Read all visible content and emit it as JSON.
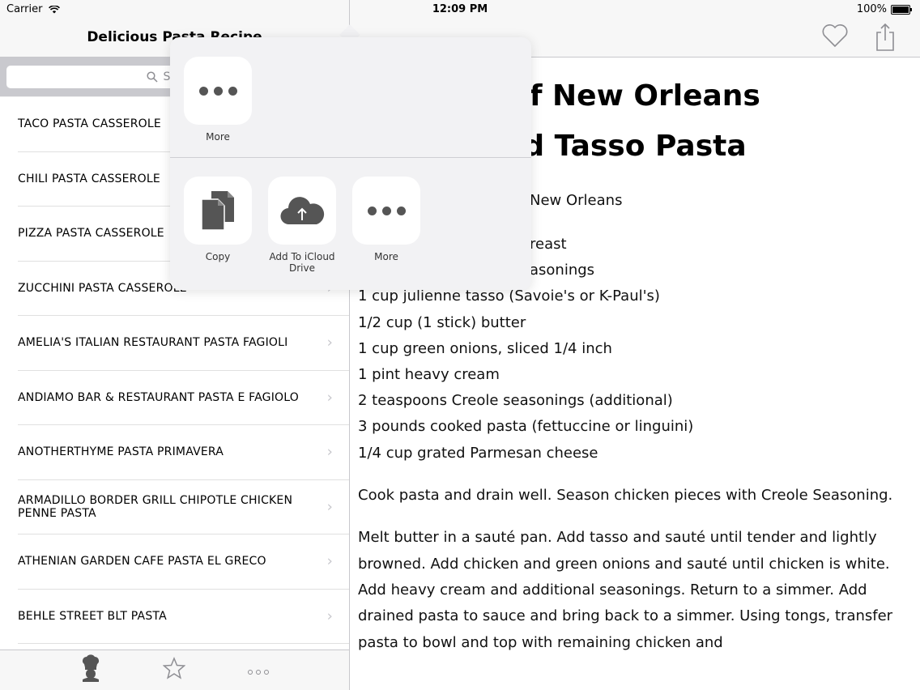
{
  "status_bar": {
    "carrier": "Carrier",
    "time": "12:09 PM",
    "battery": "100%"
  },
  "master": {
    "title": "Delicious Pasta Recipe",
    "search_placeholder": "Search",
    "recipes": [
      "TACO PASTA CASSEROLE",
      "CHILI PASTA CASSEROLE",
      "PIZZA PASTA CASSEROLE",
      "ZUCCHINI PASTA CASSEROLE",
      "AMELIA'S ITALIAN RESTAURANT PASTA FAGIOLI",
      "ANDIAMO BAR & RESTAURANT PASTA E FAGIOLO",
      "ANOTHERTHYME PASTA PRIMAVERA",
      "ARMADILLO BORDER GRILL CHIPOTLE CHICKEN PENNE PASTA",
      "ATHENIAN GARDEN CAFE PASTA EL GRECO",
      "BEHLE STREET BLT PASTA"
    ],
    "tabs": [
      "chef-icon",
      "star-icon",
      "more-dots-icon"
    ]
  },
  "detail": {
    "title_line1": "of New Orleans",
    "title_line2": "d Tasso Pasta",
    "source": "New Orleans",
    "ingredients_partial": [
      "reast",
      "asonings"
    ],
    "ingredients": [
      "1 cup julienne tasso (Savoie's or K-Paul's)",
      "1/2 cup (1 stick) butter",
      "1 cup green onions, sliced 1/4 inch",
      "1 pint heavy cream",
      "2 teaspoons Creole seasonings (additional)",
      "3 pounds cooked pasta (fettuccine or linguini)",
      "1/4 cup grated Parmesan cheese"
    ],
    "paragraph1": "Cook pasta and drain well. Season chicken pieces with Creole Seasoning.",
    "paragraph2": "Melt butter in a sauté pan. Add tasso and sauté until tender and lightly browned. Add chicken and green onions and sauté until chicken is white. Add heavy cream and additional seasonings. Return to a simmer. Add drained pasta to sauce and bring back to a simmer. Using tongs, transfer pasta to bowl and top with remaining chicken and"
  },
  "share_sheet": {
    "row1": [
      {
        "label": "More",
        "icon": "more-dots-icon"
      }
    ],
    "row2": [
      {
        "label": "Copy",
        "icon": "copy-icon"
      },
      {
        "label": "Add To iCloud Drive",
        "icon": "icloud-upload-icon"
      },
      {
        "label": "More",
        "icon": "more-dots-icon"
      }
    ]
  }
}
